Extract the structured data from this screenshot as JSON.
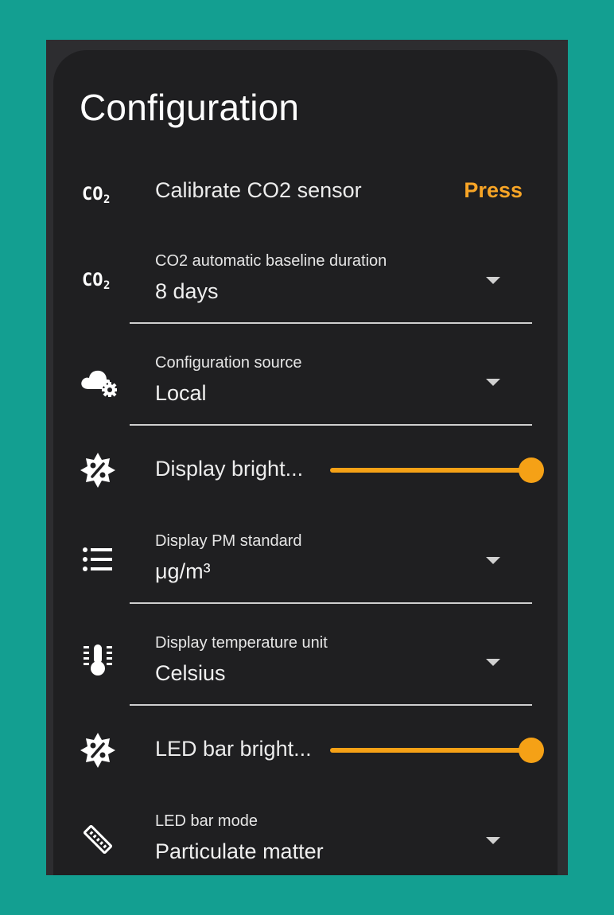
{
  "card": {
    "title": "Configuration"
  },
  "rows": {
    "calibrate": {
      "icon": "co2-icon",
      "label": "Calibrate CO2 sensor",
      "action": "Press"
    },
    "baseline": {
      "icon": "co2-icon",
      "label": "CO2 automatic baseline duration",
      "value": "8 days"
    },
    "config_source": {
      "icon": "cloud-cog-icon",
      "label": "Configuration source",
      "value": "Local"
    },
    "display_brightness": {
      "icon": "brightness-percent-icon",
      "label": "Display bright...",
      "level": 1.0
    },
    "pm_standard": {
      "icon": "format-list-bulleted-icon",
      "label": "Display PM standard",
      "value": "μg/m³"
    },
    "temp_unit": {
      "icon": "thermometer-lines-icon",
      "label": "Display temperature unit",
      "value": "Celsius"
    },
    "led_brightness": {
      "icon": "brightness-percent-icon",
      "label": "LED bar bright...",
      "level": 1.0
    },
    "led_mode": {
      "icon": "led-strip-icon",
      "label": "LED bar mode",
      "value": "Particulate matter"
    }
  },
  "colors": {
    "background": "#139f91",
    "card": "#1f1f21",
    "accent": "#f8a526",
    "slider": "#f5a116"
  }
}
